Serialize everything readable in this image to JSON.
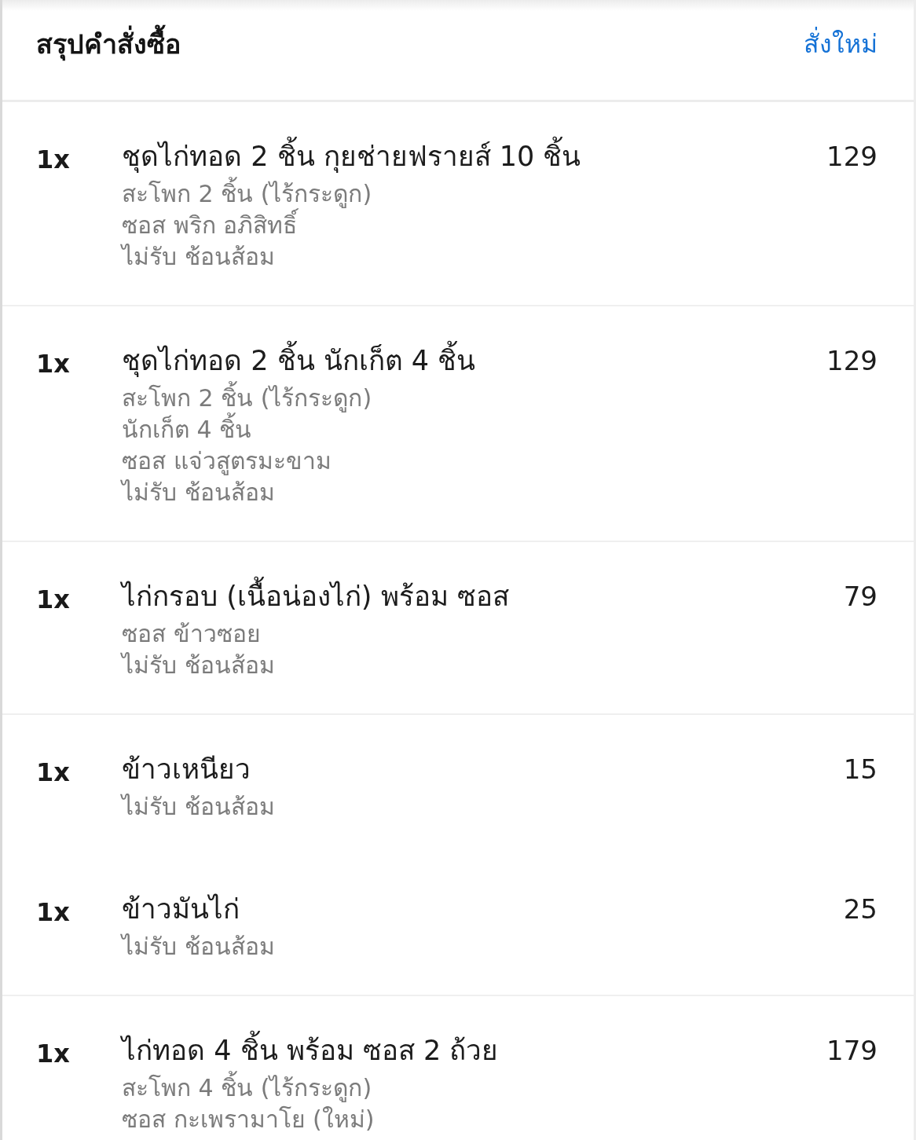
{
  "header": {
    "title": "สรุปคำสั่งซื้อ",
    "action": "สั่งใหม่"
  },
  "sections": [
    {
      "items": [
        {
          "quantity": "1x",
          "name": "ชุดไก่ทอด 2 ชิ้น กุยช่ายฟรายส์ 10 ชิ้น",
          "price": "129",
          "options": [
            "สะโพก 2 ชิ้น (ไร้กระดูก)",
            "ซอส พริก อภิสิทธิ์",
            "ไม่รับ ช้อนส้อม"
          ]
        }
      ]
    },
    {
      "items": [
        {
          "quantity": "1x",
          "name": "ชุดไก่ทอด 2 ชิ้น นักเก็ต 4 ชิ้น",
          "price": "129",
          "options": [
            "สะโพก 2 ชิ้น (ไร้กระดูก)",
            "นักเก็ต 4 ชิ้น",
            "ซอส แจ่วสูตรมะขาม",
            "ไม่รับ ช้อนส้อม"
          ]
        }
      ]
    },
    {
      "items": [
        {
          "quantity": "1x",
          "name": "ไก่กรอบ (เนื้อน่องไก่) พร้อม ซอส",
          "price": "79",
          "options": [
            "ซอส ข้าวซอย",
            "ไม่รับ ช้อนส้อม"
          ]
        }
      ]
    },
    {
      "items": [
        {
          "quantity": "1x",
          "name": "ข้าวเหนียว",
          "price": "15",
          "options": [
            "ไม่รับ ช้อนส้อม"
          ]
        },
        {
          "quantity": "1x",
          "name": "ข้าวมันไก่",
          "price": "25",
          "options": [
            "ไม่รับ ช้อนส้อม"
          ]
        }
      ]
    },
    {
      "items": [
        {
          "quantity": "1x",
          "name": "ไก่ทอด 4 ชิ้น พร้อม ซอส 2 ถ้วย",
          "price": "179",
          "options": [
            "สะโพก 4 ชิ้น (ไร้กระดูก)",
            "ซอส กะเพรามาโย (ใหม่)"
          ]
        }
      ]
    }
  ]
}
